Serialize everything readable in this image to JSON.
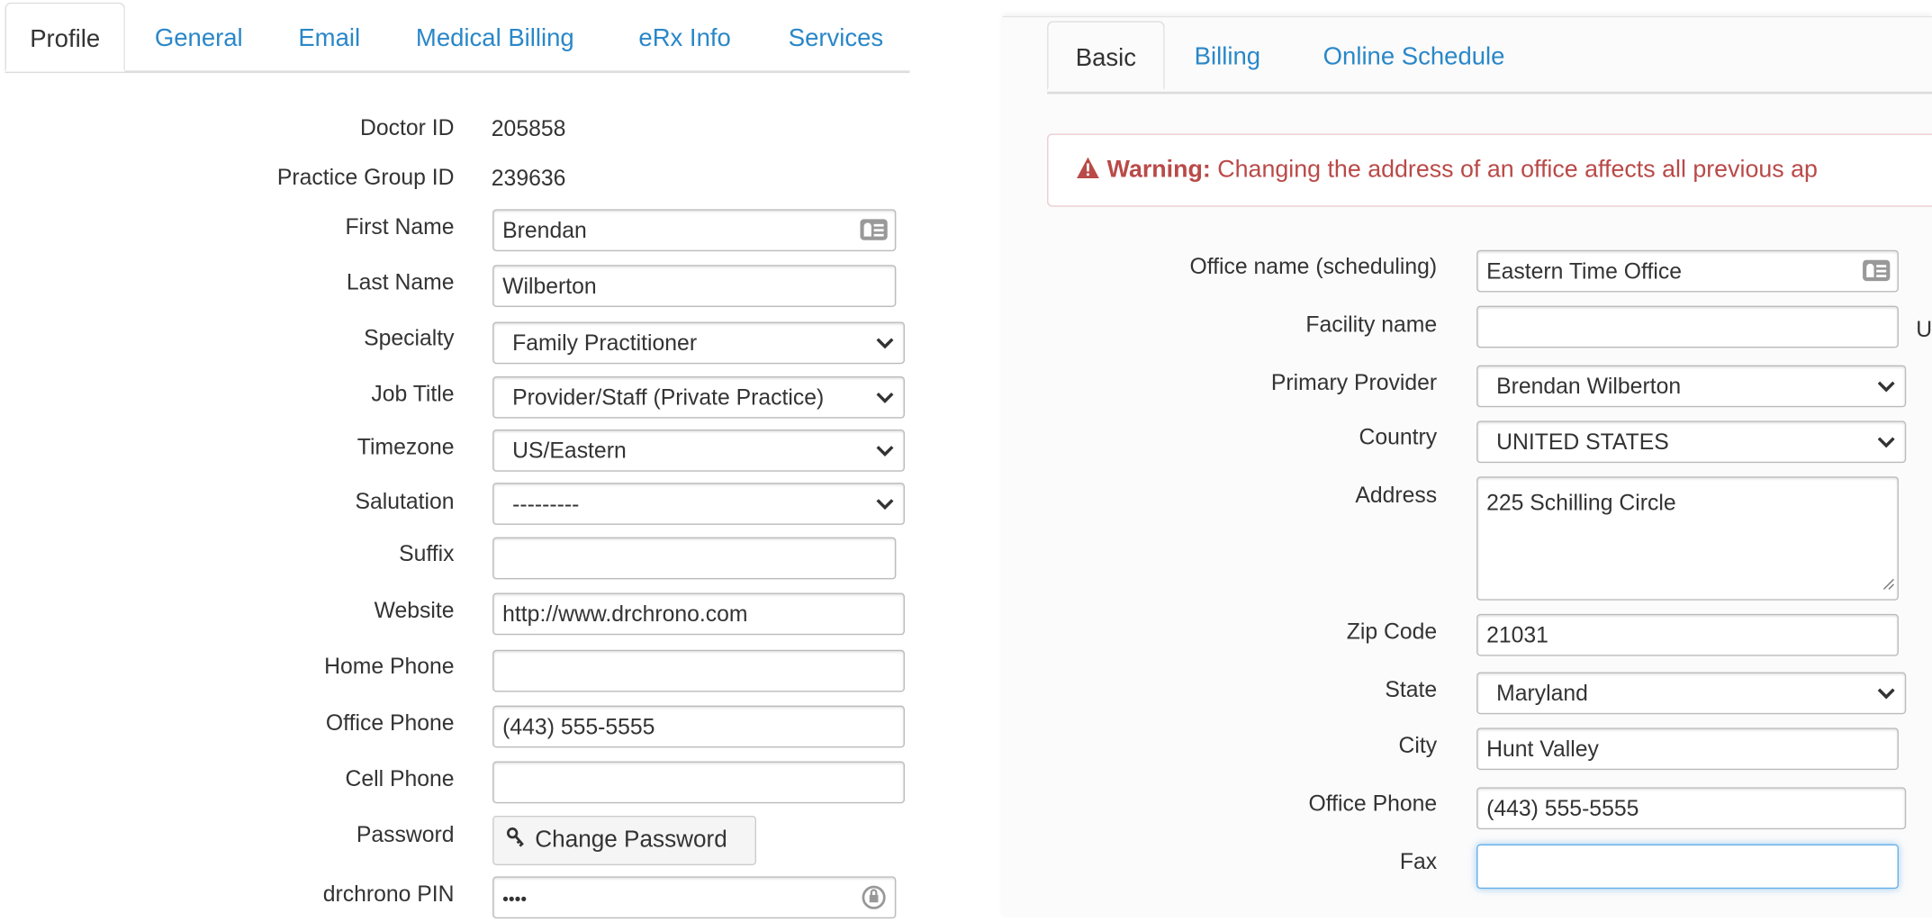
{
  "profile": {
    "tabs": [
      {
        "label": "Profile",
        "active": true
      },
      {
        "label": "General"
      },
      {
        "label": "Email"
      },
      {
        "label": "Medical Billing"
      },
      {
        "label": "eRx Info"
      },
      {
        "label": "Services"
      }
    ],
    "doctor_id": {
      "label": "Doctor ID",
      "value": "205858"
    },
    "practice_group_id": {
      "label": "Practice Group ID",
      "value": "239636"
    },
    "first_name": {
      "label": "First Name",
      "value": "Brendan"
    },
    "last_name": {
      "label": "Last Name",
      "value": "Wilberton"
    },
    "specialty": {
      "label": "Specialty",
      "value": "Family Practitioner"
    },
    "job_title": {
      "label": "Job Title",
      "value": "Provider/Staff (Private Practice)"
    },
    "timezone": {
      "label": "Timezone",
      "value": "US/Eastern"
    },
    "salutation": {
      "label": "Salutation",
      "value": "---------"
    },
    "suffix": {
      "label": "Suffix",
      "value": ""
    },
    "website": {
      "label": "Website",
      "value": "http://www.drchrono.com"
    },
    "home_phone": {
      "label": "Home Phone",
      "value": ""
    },
    "office_phone": {
      "label": "Office Phone",
      "value": "(443) 555-5555"
    },
    "cell_phone": {
      "label": "Cell Phone",
      "value": ""
    },
    "password": {
      "label": "Password",
      "button": "Change Password"
    },
    "pin": {
      "label": "drchrono PIN",
      "value": "••••"
    }
  },
  "office": {
    "tabs": [
      {
        "label": "Basic",
        "active": true
      },
      {
        "label": "Billing"
      },
      {
        "label": "Online Schedule"
      }
    ],
    "warning": {
      "title": "Warning:",
      "text": "Changing the address of an office affects all previous ap"
    },
    "office_name": {
      "label": "Office name (scheduling)",
      "value": "Eastern Time Office"
    },
    "facility_name": {
      "label": "Facility name",
      "value": "",
      "trailing": "U"
    },
    "primary_provider": {
      "label": "Primary Provider",
      "value": "Brendan Wilberton"
    },
    "country": {
      "label": "Country",
      "value": "UNITED STATES"
    },
    "address": {
      "label": "Address",
      "value": "225 Schilling Circle"
    },
    "zip": {
      "label": "Zip Code",
      "value": "21031"
    },
    "state": {
      "label": "State",
      "value": "Maryland"
    },
    "city": {
      "label": "City",
      "value": "Hunt Valley"
    },
    "office_phone": {
      "label": "Office Phone",
      "value": "(443) 555-5555"
    },
    "fax": {
      "label": "Fax",
      "value": ""
    }
  },
  "colors": {
    "link": "#2a87c8",
    "warning": "#b94a48",
    "focus": "#66afe9"
  }
}
